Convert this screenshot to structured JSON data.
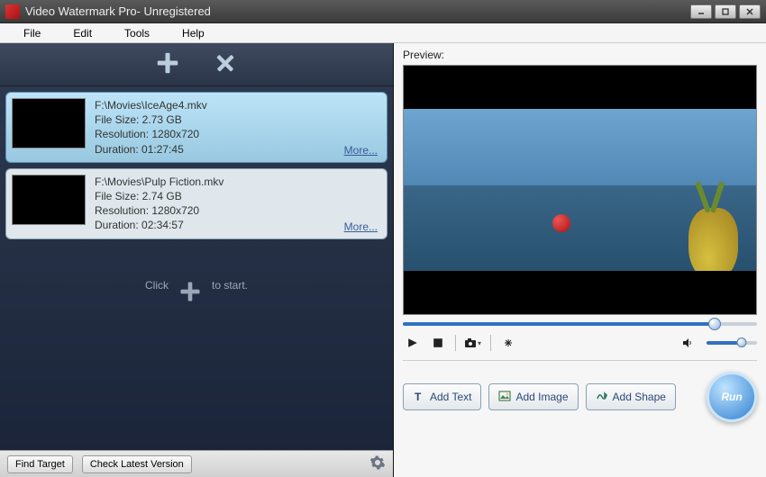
{
  "window": {
    "title": "Video Watermark Pro- Unregistered"
  },
  "menu": {
    "file": "File",
    "edit": "Edit",
    "tools": "Tools",
    "help": "Help"
  },
  "toolbar": {
    "add_tip": "Add",
    "remove_tip": "Remove"
  },
  "files": [
    {
      "path": "F:\\Movies\\IceAge4.mkv",
      "size_label": "File Size: 2.73 GB",
      "res_label": "Resolution: 1280x720",
      "dur_label": "Duration: 01:27:45",
      "more": "More..."
    },
    {
      "path": "F:\\Movies\\Pulp Fiction.mkv",
      "size_label": "File Size: 2.74 GB",
      "res_label": "Resolution: 1280x720",
      "dur_label": "Duration: 02:34:57",
      "more": "More..."
    }
  ],
  "clickstart": {
    "before": "Click",
    "after": "to start."
  },
  "bottom": {
    "find_target": "Find Target",
    "check_latest": "Check Latest Version"
  },
  "preview": {
    "label": "Preview:"
  },
  "actions": {
    "add_text": "Add Text",
    "add_image": "Add Image",
    "add_shape": "Add Shape",
    "run": "Run"
  }
}
